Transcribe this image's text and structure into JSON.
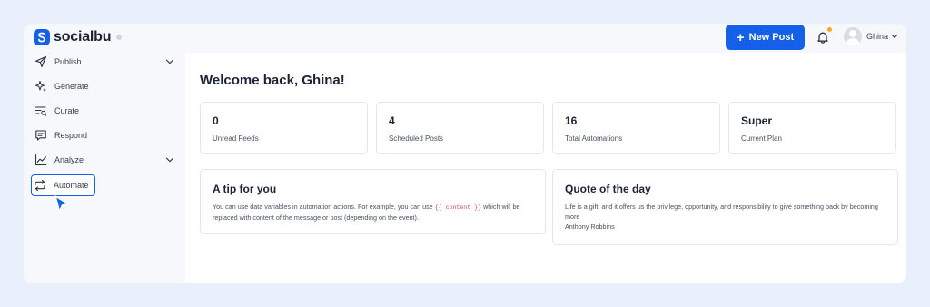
{
  "brand": {
    "name": "socialbu",
    "accent": "#1560e8"
  },
  "header": {
    "new_post_label": "New Post",
    "notification_count": "1",
    "user_name": "Ghina"
  },
  "sidebar": {
    "items": [
      {
        "label": "Publish",
        "icon": "send-icon",
        "has_chevron": true
      },
      {
        "label": "Generate",
        "icon": "sparkle-icon",
        "has_chevron": false
      },
      {
        "label": "Curate",
        "icon": "filter-search-icon",
        "has_chevron": false
      },
      {
        "label": "Respond",
        "icon": "chat-icon",
        "has_chevron": false
      },
      {
        "label": "Analyze",
        "icon": "line-chart-icon",
        "has_chevron": true
      },
      {
        "label": "Automate",
        "icon": "repeat-icon",
        "has_chevron": false,
        "active": true
      }
    ]
  },
  "main": {
    "welcome": "Welcome back, Ghina!",
    "stats": [
      {
        "value": "0",
        "label": "Unread Feeds"
      },
      {
        "value": "4",
        "label": "Scheduled Posts"
      },
      {
        "value": "16",
        "label": "Total Automations"
      },
      {
        "value": "Super",
        "label": "Current Plan"
      }
    ],
    "tip": {
      "title": "A tip for you",
      "text_before": "You can use data variables in automation actions. For example, you can use ",
      "code": "{{ content }}",
      "text_after": " which will be replaced with content of the message or post (depending on the event)."
    },
    "quote": {
      "title": "Quote of the day",
      "text": "Life is a gift, and it offers us the privilege, opportunity, and responsibility to give something back by becoming more",
      "author": "Anthony Robbins"
    }
  }
}
